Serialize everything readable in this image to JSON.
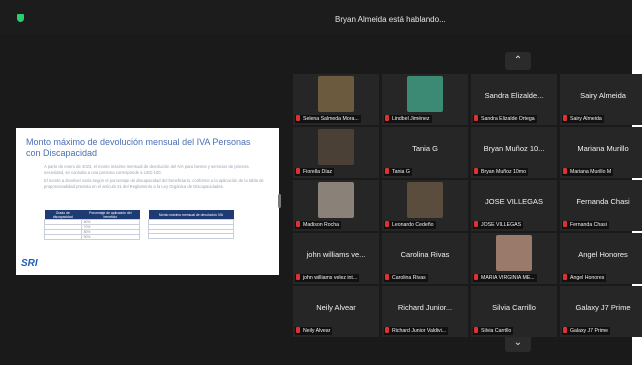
{
  "meeting": {
    "speaking_status": "Bryan Almeida está hablando..."
  },
  "shared_slide": {
    "title": "Monto máximo de devolución mensual del IVA Personas con Discapacidad",
    "paragraph1": "A partir de enero de 2023, el monto máximo mensual de devolución del IVA para bienes y servicios de primera necesidad, se consulta a una persona corresponde a USD 100.",
    "paragraph2": "El monto a devolver varía según el porcentaje de discapacidad del beneficiario, conforme a la aplicación de la tabla de proporcionalidad prevista en el artículo 21 del Reglamento a la Ley Orgánica de Discapacidades.",
    "table1_headers": [
      "Grado de discapacidad",
      "Porcentaje de aplicación del beneficio"
    ],
    "table1_rows": [
      [
        "",
        "60%"
      ],
      [
        "",
        "70%"
      ],
      [
        "",
        "80%"
      ],
      [
        "",
        "90%"
      ]
    ],
    "table2_header": "Monto máximo mensual de devolución IVA",
    "table2_rows": [
      "",
      "",
      "",
      ""
    ],
    "logo": "SRI"
  },
  "gallery": {
    "tiles": [
      {
        "name": "",
        "label": "Selena Salmeda Mora...",
        "has_video": true,
        "video_color": "#6b5a3e"
      },
      {
        "name": "",
        "label": "Lindbel Jiménez",
        "has_video": true,
        "video_color": "#3d8a74"
      },
      {
        "name": "Sandra Elizalde...",
        "label": "Sandra Elizalde Ortega",
        "has_video": false
      },
      {
        "name": "Sairy Almeida",
        "label": "Sairy Almeida",
        "has_video": false
      },
      {
        "name": "",
        "label": "Fiorella Díaz",
        "has_video": true,
        "video_color": "#4a4036"
      },
      {
        "name": "Tania G",
        "label": "Tania G",
        "has_video": false
      },
      {
        "name": "Bryan Muñoz 10...",
        "label": "Bryan Muñoz 10mo",
        "has_video": false
      },
      {
        "name": "Mariana Murillo",
        "label": "Mariana Murillo M",
        "has_video": false
      },
      {
        "name": "",
        "label": "Madison Rocha",
        "has_video": true,
        "video_color": "#8a8278"
      },
      {
        "name": "",
        "label": "Leonardo Cedeño",
        "has_video": true,
        "video_color": "#5a4d3e"
      },
      {
        "name": "JOSE VILLEGAS",
        "label": "JOSE VILLEGAS",
        "has_video": false
      },
      {
        "name": "Fernanda Chasi",
        "label": "Fernanda Chasi",
        "has_video": false
      },
      {
        "name": "john williams ve...",
        "label": "john williams velez int...",
        "has_video": false
      },
      {
        "name": "Carolina Rivas",
        "label": "Carolina Rivas",
        "has_video": false
      },
      {
        "name": "",
        "label": "MARIA VIRGINIA ME...",
        "has_video": true,
        "video_color": "#9a7a6a"
      },
      {
        "name": "Angel Honores",
        "label": "Angel Honores",
        "has_video": false
      },
      {
        "name": "Neily Alvear",
        "label": "Neily Alvear",
        "has_video": false
      },
      {
        "name": "Richard Junior...",
        "label": "Richard Junior Valdivi...",
        "has_video": false
      },
      {
        "name": "Silvia Carrillo",
        "label": "Silvia Carrillo",
        "has_video": false
      },
      {
        "name": "Galaxy J7 Prime",
        "label": "Galaxy J7 Prime",
        "has_video": false
      }
    ]
  },
  "colors": {
    "mic_muted": "#e03131",
    "encryption": "#2ecc71"
  }
}
